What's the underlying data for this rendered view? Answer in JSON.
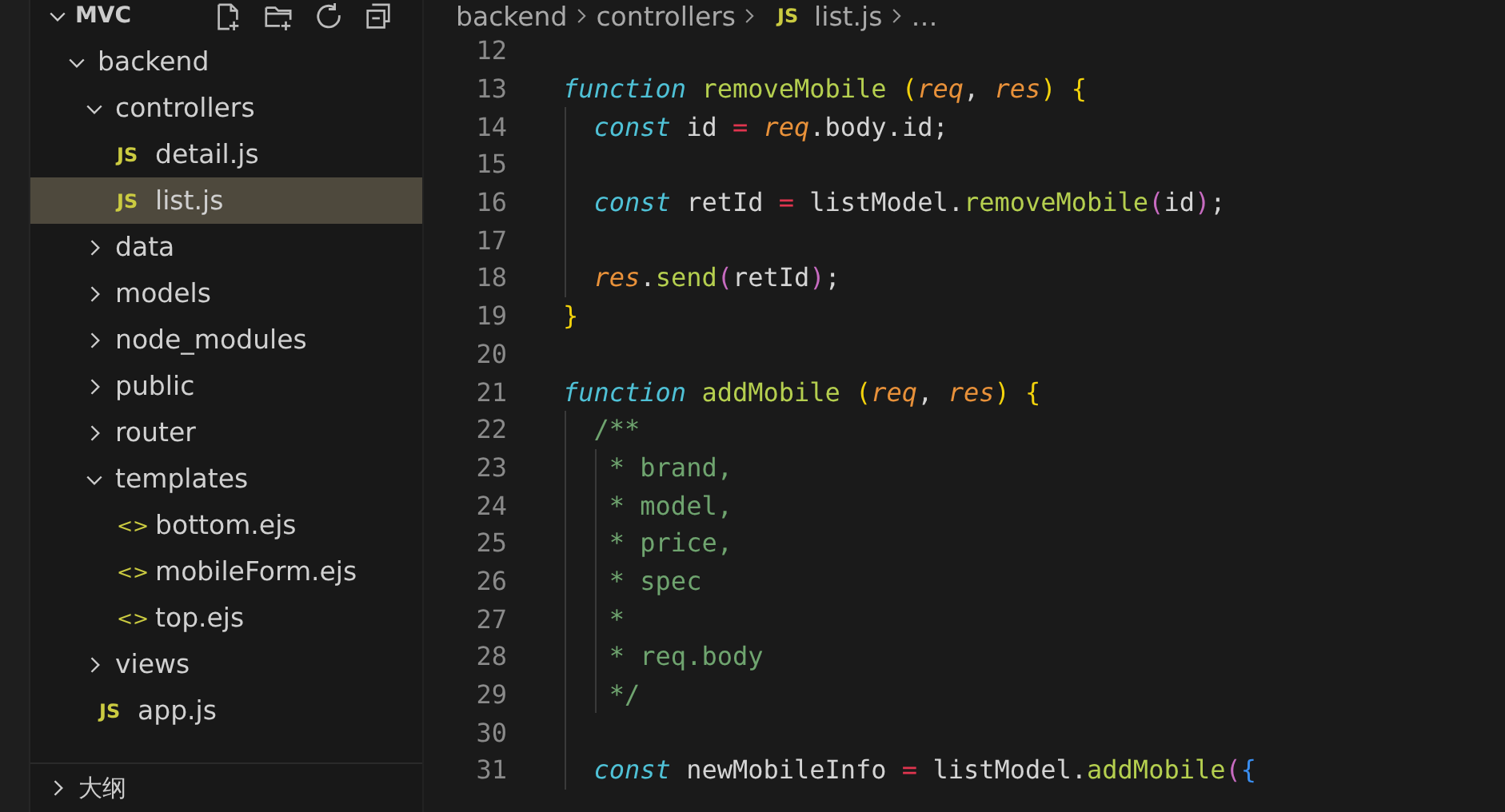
{
  "explorer": {
    "title": "MVC",
    "expanded": true,
    "tree": [
      {
        "name": "backend",
        "kind": "folder",
        "expanded": true,
        "selected": false,
        "children": [
          {
            "name": "controllers",
            "kind": "folder",
            "expanded": true,
            "selected": false,
            "children": [
              {
                "name": "detail.js",
                "kind": "js",
                "badge": "JS",
                "selected": false
              },
              {
                "name": "list.js",
                "kind": "js",
                "badge": "JS",
                "selected": true
              }
            ]
          },
          {
            "name": "data",
            "kind": "folder",
            "expanded": false,
            "selected": false
          },
          {
            "name": "models",
            "kind": "folder",
            "expanded": false,
            "selected": false
          },
          {
            "name": "node_modules",
            "kind": "folder",
            "expanded": false,
            "selected": false
          },
          {
            "name": "public",
            "kind": "folder",
            "expanded": false,
            "selected": false
          },
          {
            "name": "router",
            "kind": "folder",
            "expanded": false,
            "selected": false
          },
          {
            "name": "templates",
            "kind": "folder",
            "expanded": true,
            "selected": false,
            "children": [
              {
                "name": "bottom.ejs",
                "kind": "ejs",
                "badge": "<>",
                "selected": false
              },
              {
                "name": "mobileForm.ejs",
                "kind": "ejs",
                "badge": "<>",
                "selected": false
              },
              {
                "name": "top.ejs",
                "kind": "ejs",
                "badge": "<>",
                "selected": false
              }
            ]
          },
          {
            "name": "views",
            "kind": "folder",
            "expanded": false,
            "selected": false
          },
          {
            "name": "app.js",
            "kind": "js",
            "badge": "JS",
            "selected": false
          }
        ]
      }
    ]
  },
  "outline": {
    "title": "大纲",
    "expanded": false
  },
  "breadcrumb": [
    {
      "text": "backend"
    },
    {
      "text": "controllers"
    },
    {
      "text": "list.js",
      "badge": "JS"
    },
    {
      "text": "…"
    }
  ],
  "code": [
    {
      "number": "12"
    },
    {
      "number": "13",
      "tokens": [
        {
          "t": "function",
          "kind": "keyword"
        },
        {
          "t": " removeMobile",
          "kind": "function"
        },
        {
          "t": " (",
          "kind": "bracket"
        },
        {
          "t": "req",
          "kind": "parameter"
        },
        {
          "t": ","
        },
        {
          "t": " res",
          "kind": "parameter"
        },
        {
          "t": ")",
          "kind": "bracket"
        },
        {
          "t": " {",
          "kind": "bracket"
        }
      ]
    },
    {
      "number": "14",
      "tokens": [
        {
          "t": "  const",
          "kind": "keyword"
        },
        {
          "t": " id"
        },
        {
          "t": " =",
          "kind": "operator"
        },
        {
          "t": " req",
          "kind": "parameter"
        },
        {
          "t": ".body.id;"
        }
      ]
    },
    {
      "number": "15"
    },
    {
      "number": "16",
      "tokens": [
        {
          "t": "  const",
          "kind": "keyword"
        },
        {
          "t": " retId"
        },
        {
          "t": " =",
          "kind": "operator"
        },
        {
          "t": " listModel."
        },
        {
          "t": "removeMobile",
          "kind": "function"
        },
        {
          "t": "(",
          "kind": "paren"
        },
        {
          "t": "id"
        },
        {
          "t": ")",
          "kind": "paren"
        },
        {
          "t": ";"
        }
      ]
    },
    {
      "number": "17"
    },
    {
      "number": "18",
      "tokens": [
        {
          "t": "  res",
          "kind": "parameter"
        },
        {
          "t": "."
        },
        {
          "t": "send",
          "kind": "function"
        },
        {
          "t": "(",
          "kind": "paren"
        },
        {
          "t": "retId"
        },
        {
          "t": ")",
          "kind": "paren"
        },
        {
          "t": ";"
        }
      ]
    },
    {
      "number": "19",
      "tokens": [
        {
          "t": "}",
          "kind": "bracket"
        }
      ]
    },
    {
      "number": "20"
    },
    {
      "number": "21",
      "tokens": [
        {
          "t": "function",
          "kind": "keyword"
        },
        {
          "t": " addMobile",
          "kind": "function"
        },
        {
          "t": " (",
          "kind": "bracket"
        },
        {
          "t": "req",
          "kind": "parameter"
        },
        {
          "t": ","
        },
        {
          "t": " res",
          "kind": "parameter"
        },
        {
          "t": ")",
          "kind": "bracket"
        },
        {
          "t": " {",
          "kind": "bracket"
        }
      ]
    },
    {
      "number": "22",
      "tokens": [
        {
          "t": "  /**",
          "kind": "comment"
        }
      ]
    },
    {
      "number": "23",
      "tokens": [
        {
          "t": "   * brand,",
          "kind": "comment"
        }
      ]
    },
    {
      "number": "24",
      "tokens": [
        {
          "t": "   * model,",
          "kind": "comment"
        }
      ]
    },
    {
      "number": "25",
      "tokens": [
        {
          "t": "   * price,",
          "kind": "comment"
        }
      ]
    },
    {
      "number": "26",
      "tokens": [
        {
          "t": "   * spec",
          "kind": "comment"
        }
      ]
    },
    {
      "number": "27",
      "tokens": [
        {
          "t": "   *",
          "kind": "comment"
        }
      ]
    },
    {
      "number": "28",
      "tokens": [
        {
          "t": "   * req.body",
          "kind": "comment"
        }
      ]
    },
    {
      "number": "29",
      "tokens": [
        {
          "t": "   */",
          "kind": "comment"
        }
      ]
    },
    {
      "number": "30"
    },
    {
      "number": "31",
      "tokens": [
        {
          "t": "  const",
          "kind": "keyword"
        },
        {
          "t": " newMobileInfo"
        },
        {
          "t": " =",
          "kind": "operator"
        },
        {
          "t": " listModel."
        },
        {
          "t": "addMobile",
          "kind": "function"
        },
        {
          "t": "(",
          "kind": "paren"
        },
        {
          "t": "{",
          "kind": "brace"
        }
      ]
    }
  ]
}
